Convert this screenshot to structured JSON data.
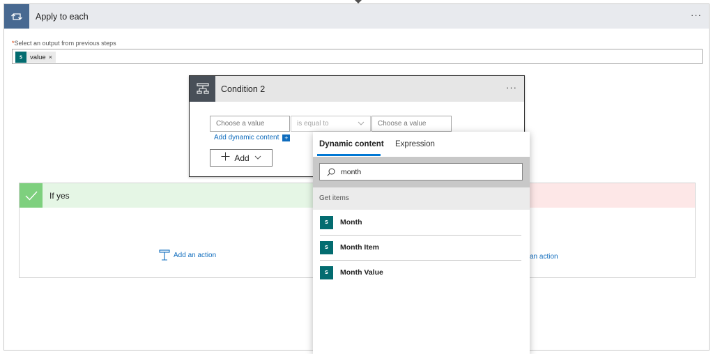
{
  "apply": {
    "title": "Apply to each",
    "more": "···",
    "field_label": "Select an output from previous steps",
    "required_mark": "*",
    "token": {
      "icon_text": "S",
      "label": "value",
      "remove": "×"
    }
  },
  "condition": {
    "title": "Condition 2",
    "more": "···",
    "left_placeholder": "Choose a value",
    "operator": "is equal to",
    "right_placeholder": "Choose a value",
    "add_dynamic_label": "Add dynamic content",
    "add_dynamic_plus": "+",
    "add_button_label": "Add"
  },
  "branches": {
    "yes_title": "If yes",
    "add_action_yes": "Add an action",
    "add_action_no": "an action"
  },
  "flyout": {
    "tabs": [
      {
        "label": "Dynamic content"
      },
      {
        "label": "Expression"
      }
    ],
    "search_value": "month",
    "group_header": "Get items",
    "items": [
      {
        "label": "Month"
      },
      {
        "label": "Month Item"
      },
      {
        "label": "Month Value"
      }
    ]
  },
  "colors": {
    "apply_icon_bg": "#486991",
    "condition_icon_bg": "#484f58",
    "yes_header_bg": "#e5f6e5",
    "no_header_bg": "#fde7e7",
    "sharepoint": "#036c70",
    "link": "#0f6cbd",
    "tab_accent": "#0078d4"
  }
}
